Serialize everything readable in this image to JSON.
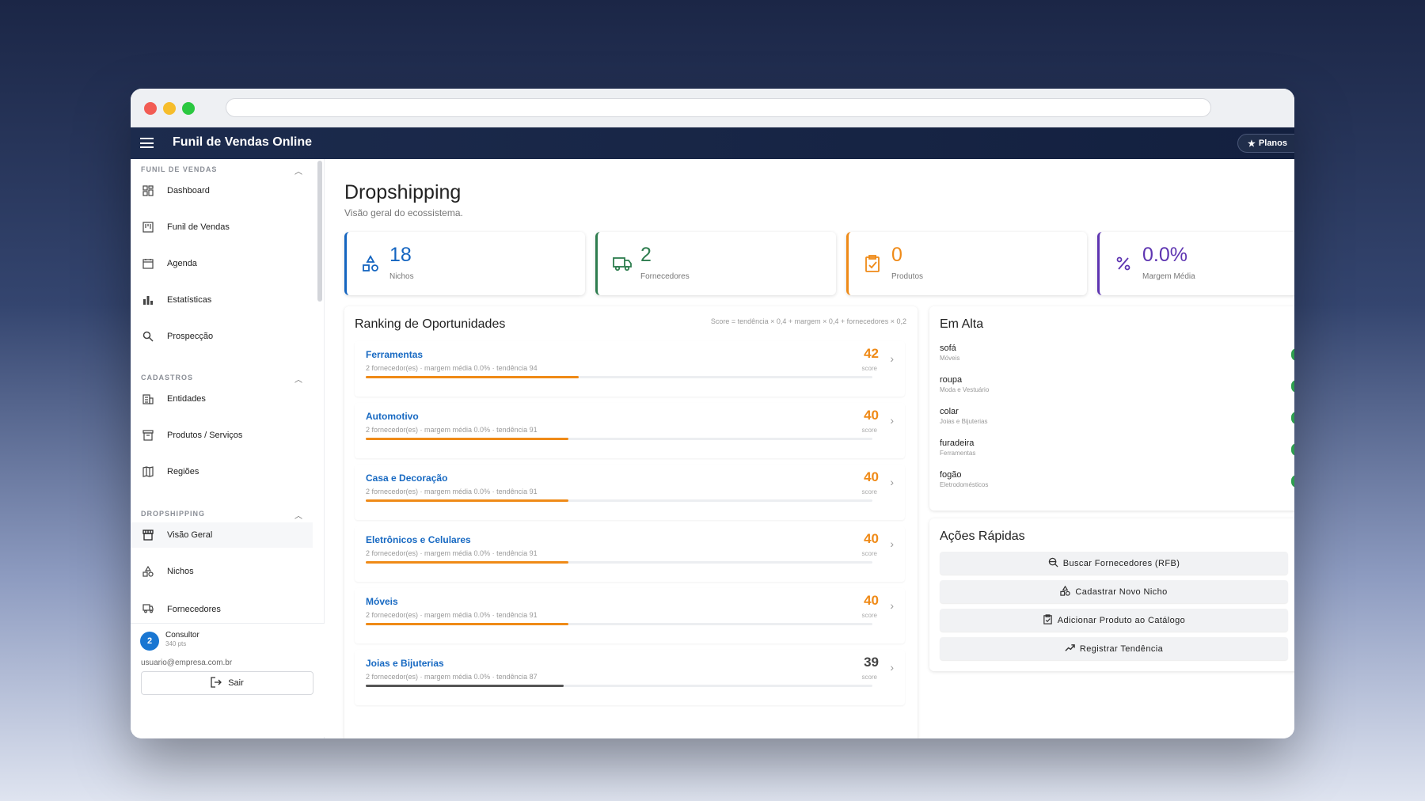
{
  "app": {
    "title": "Funil de Vendas Online",
    "planos_label": "Planos"
  },
  "sidebar": {
    "sections": [
      {
        "heading": "FUNIL DE VENDAS",
        "items": [
          {
            "label": "Dashboard",
            "icon": "grid-icon"
          },
          {
            "label": "Funil de Vendas",
            "icon": "kanban-icon"
          },
          {
            "label": "Agenda",
            "icon": "calendar-icon"
          },
          {
            "label": "Estatísticas",
            "icon": "bar-chart-icon"
          },
          {
            "label": "Prospecção",
            "icon": "search-icon"
          }
        ]
      },
      {
        "heading": "CADASTROS",
        "items": [
          {
            "label": "Entidades",
            "icon": "building-icon"
          },
          {
            "label": "Produtos / Serviços",
            "icon": "archive-icon"
          },
          {
            "label": "Regiões",
            "icon": "map-icon"
          }
        ]
      },
      {
        "heading": "DROPSHIPPING",
        "items": [
          {
            "label": "Visão Geral",
            "icon": "store-icon",
            "active": true
          },
          {
            "label": "Nichos",
            "icon": "shapes-icon"
          },
          {
            "label": "Fornecedores",
            "icon": "truck-icon"
          }
        ]
      }
    ],
    "user": {
      "avatar": "2",
      "role": "Consultor",
      "points": "340 pts",
      "email": "usuario@empresa.com.br",
      "logout_label": "Sair"
    }
  },
  "page": {
    "title": "Dropshipping",
    "subtitle": "Visão geral do ecossistema."
  },
  "stats": [
    {
      "value": "18",
      "label": "Nichos",
      "color": "#1565c0",
      "icon": "shapes-icon"
    },
    {
      "value": "2",
      "label": "Fornecedores",
      "color": "#2e7d4f",
      "icon": "truck-icon"
    },
    {
      "value": "0",
      "label": "Produtos",
      "color": "#ef8a17",
      "icon": "clipboard-check-icon"
    },
    {
      "value": "0.0%",
      "label": "Margem Média",
      "color": "#5e35b1",
      "icon": "percent-icon"
    }
  ],
  "ranking": {
    "title": "Ranking de Oportunidades",
    "note": "Score = tendência × 0,4 + margem × 0,4 + fornecedores × 0,2",
    "score_label": "score",
    "rows": [
      {
        "name": "Ferramentas",
        "meta": "2 fornecedor(es) · margem média 0.0% · tendência 94",
        "score": 42,
        "fill": 0.42,
        "color": "#ef8a17"
      },
      {
        "name": "Automotivo",
        "meta": "2 fornecedor(es) · margem média 0.0% · tendência 91",
        "score": 40,
        "fill": 0.4,
        "color": "#ef8a17"
      },
      {
        "name": "Casa e Decoração",
        "meta": "2 fornecedor(es) · margem média 0.0% · tendência 91",
        "score": 40,
        "fill": 0.4,
        "color": "#ef8a17"
      },
      {
        "name": "Eletrônicos e Celulares",
        "meta": "2 fornecedor(es) · margem média 0.0% · tendência 91",
        "score": 40,
        "fill": 0.4,
        "color": "#ef8a17"
      },
      {
        "name": "Móveis",
        "meta": "2 fornecedor(es) · margem média 0.0% · tendência 91",
        "score": 40,
        "fill": 0.4,
        "color": "#ef8a17"
      },
      {
        "name": "Joias e Bijuterias",
        "meta": "2 fornecedor(es) · margem média 0.0% · tendência 87",
        "score": 39,
        "fill": 0.39,
        "color": "#555555"
      }
    ]
  },
  "trending": {
    "title": "Em Alta",
    "items": [
      {
        "term": "sofá",
        "category": "Móveis"
      },
      {
        "term": "roupa",
        "category": "Moda e Vestuário"
      },
      {
        "term": "colar",
        "category": "Joias e Bijuterias"
      },
      {
        "term": "furadeira",
        "category": "Ferramentas"
      },
      {
        "term": "fogão",
        "category": "Eletrodomésticos"
      }
    ]
  },
  "quick_actions": {
    "title": "Ações Rápidas",
    "buttons": [
      {
        "label": "Buscar Fornecedores (RFB)",
        "icon": "search-globe-icon"
      },
      {
        "label": "Cadastrar Novo Nicho",
        "icon": "shapes-icon"
      },
      {
        "label": "Adicionar Produto ao Catálogo",
        "icon": "clipboard-check-icon"
      },
      {
        "label": "Registrar Tendência",
        "icon": "trending-up-icon"
      }
    ]
  }
}
